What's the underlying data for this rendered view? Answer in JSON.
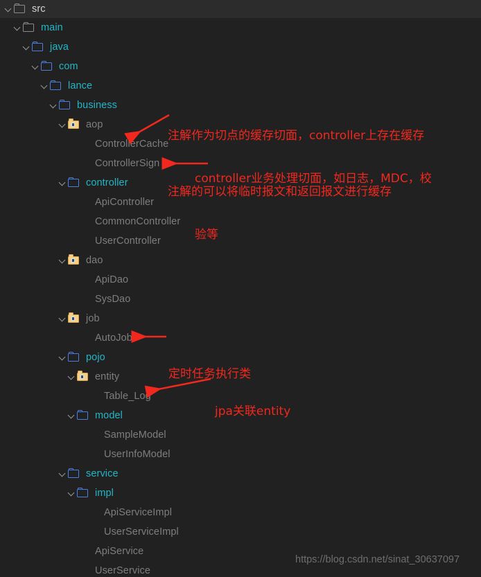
{
  "window": {
    "background_color": "#212121",
    "header_background_color": "#2c2c2c",
    "accent_cyan": "#23b6c6",
    "accent_blue": "#4a7fe0",
    "accent_yellow": "#f4d08a",
    "annotation_color": "#f2281e",
    "file_text_color": "#7e7e7e"
  },
  "header": {
    "label": "src",
    "icon": "folder-outline-icon",
    "chevron": "chevron-down-icon",
    "selected": true
  },
  "tree": {
    "items": [
      {
        "label": "main",
        "depth": 1,
        "icon": "folder-gray-icon",
        "expandable": true,
        "color": "cyan"
      },
      {
        "label": "java",
        "depth": 2,
        "icon": "folder-blue-icon",
        "expandable": true,
        "color": "cyan"
      },
      {
        "label": "com",
        "depth": 3,
        "icon": "folder-blue-icon",
        "expandable": true,
        "color": "cyan"
      },
      {
        "label": "lance",
        "depth": 4,
        "icon": "folder-blue-icon",
        "expandable": true,
        "color": "cyan"
      },
      {
        "label": "business",
        "depth": 5,
        "icon": "folder-blue-icon",
        "expandable": true,
        "color": "cyan"
      },
      {
        "label": "aop",
        "depth": 6,
        "icon": "folder-yellow-icon",
        "expandable": true,
        "color": "gray"
      },
      {
        "label": "ControllerCache",
        "depth": 7,
        "icon": "none",
        "expandable": false,
        "color": "gray"
      },
      {
        "label": "ControllerSign",
        "depth": 7,
        "icon": "none",
        "expandable": false,
        "color": "gray"
      },
      {
        "label": "controller",
        "depth": 6,
        "icon": "folder-blue-icon",
        "expandable": true,
        "color": "cyan"
      },
      {
        "label": "ApiController",
        "depth": 7,
        "icon": "none",
        "expandable": false,
        "color": "gray"
      },
      {
        "label": "CommonController",
        "depth": 7,
        "icon": "none",
        "expandable": false,
        "color": "gray"
      },
      {
        "label": "UserController",
        "depth": 7,
        "icon": "none",
        "expandable": false,
        "color": "gray"
      },
      {
        "label": "dao",
        "depth": 6,
        "icon": "folder-yellow-icon",
        "expandable": true,
        "color": "gray"
      },
      {
        "label": "ApiDao",
        "depth": 7,
        "icon": "none",
        "expandable": false,
        "color": "gray"
      },
      {
        "label": "SysDao",
        "depth": 7,
        "icon": "none",
        "expandable": false,
        "color": "gray"
      },
      {
        "label": "job",
        "depth": 6,
        "icon": "folder-yellow-icon",
        "expandable": true,
        "color": "gray"
      },
      {
        "label": "AutoJob",
        "depth": 7,
        "icon": "none",
        "expandable": false,
        "color": "gray"
      },
      {
        "label": "pojo",
        "depth": 6,
        "icon": "folder-blue-icon",
        "expandable": true,
        "color": "cyan"
      },
      {
        "label": "entity",
        "depth": 7,
        "icon": "folder-yellow-icon",
        "expandable": true,
        "color": "gray"
      },
      {
        "label": "Table_Log",
        "depth": 8,
        "icon": "none",
        "expandable": false,
        "color": "gray"
      },
      {
        "label": "model",
        "depth": 7,
        "icon": "folder-blue-icon",
        "expandable": true,
        "color": "cyan"
      },
      {
        "label": "SampleModel",
        "depth": 8,
        "icon": "none",
        "expandable": false,
        "color": "gray"
      },
      {
        "label": "UserInfoModel",
        "depth": 8,
        "icon": "none",
        "expandable": false,
        "color": "gray"
      },
      {
        "label": "service",
        "depth": 6,
        "icon": "folder-blue-icon",
        "expandable": true,
        "color": "cyan"
      },
      {
        "label": "impl",
        "depth": 7,
        "icon": "folder-blue-icon",
        "expandable": true,
        "color": "cyan"
      },
      {
        "label": "ApiServiceImpl",
        "depth": 8,
        "icon": "none",
        "expandable": false,
        "color": "gray"
      },
      {
        "label": "UserServiceImpl",
        "depth": 8,
        "icon": "none",
        "expandable": false,
        "color": "gray"
      },
      {
        "label": "ApiService",
        "depth": 7,
        "icon": "none",
        "expandable": false,
        "color": "gray"
      },
      {
        "label": "UserService",
        "depth": 7,
        "icon": "none",
        "expandable": false,
        "color": "gray"
      }
    ]
  },
  "annotations": [
    {
      "id": "aop-cache-note",
      "line1": "注解作为切点的缓存切面，controller上存在缓存",
      "line2": "注解的可以将临时报文和返回报文进行缓存",
      "target": "ControllerCache"
    },
    {
      "id": "controller-sign-note",
      "line1": "controller业务处理切面，如日志，MDC，校",
      "line2": "验等",
      "target": "ControllerSign"
    },
    {
      "id": "autojob-note",
      "line1": "定时任务执行类",
      "line2": "",
      "target": "AutoJob"
    },
    {
      "id": "entity-note",
      "line1": "jpa关联entity",
      "line2": "",
      "target": "entity"
    }
  ],
  "watermark": {
    "text": "https://blog.csdn.net/sinat_30637097"
  }
}
